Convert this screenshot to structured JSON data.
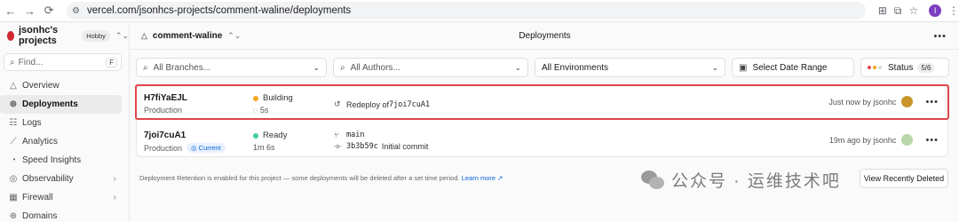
{
  "browser": {
    "url": "vercel.com/jsonhcs-projects/comment-waline/deployments",
    "back_icon": "←",
    "forward_icon": "→",
    "reload_icon": "⟳",
    "profile_initial": "I"
  },
  "sidebar": {
    "team_name": "jsonhc's projects",
    "plan": "Hobby",
    "find_placeholder": "Find...",
    "find_shortcut": "F",
    "items": [
      {
        "label": "Overview",
        "icon": "△",
        "active": false,
        "chevron": false
      },
      {
        "label": "Deployments",
        "icon": "⊛",
        "active": true,
        "chevron": false
      },
      {
        "label": "Logs",
        "icon": "☷",
        "active": false,
        "chevron": false
      },
      {
        "label": "Analytics",
        "icon": "⟋",
        "active": false,
        "chevron": false
      },
      {
        "label": "Speed Insights",
        "icon": "◔",
        "active": false,
        "chevron": false
      },
      {
        "label": "Observability",
        "icon": "◎",
        "active": false,
        "chevron": true
      },
      {
        "label": "Firewall",
        "icon": "▦",
        "active": false,
        "chevron": true
      },
      {
        "label": "Domains",
        "icon": "⊕",
        "active": false,
        "chevron": false
      }
    ]
  },
  "header": {
    "project_name": "comment-waline",
    "page_title": "Deployments",
    "more_icon": "•••"
  },
  "filters": {
    "branches_placeholder": "All Branches...",
    "authors_placeholder": "All Authors...",
    "environments_label": "All Environments",
    "date_label": "Select Date Range",
    "status_label": "Status",
    "status_count": "5/6",
    "status_dot_colors": [
      "#e5484d",
      "#f5a623",
      "#d9d9d9"
    ]
  },
  "deployments": [
    {
      "id": "H7fiYaEJL",
      "environment": "Production",
      "current": false,
      "status": "Building",
      "status_color": "#f5a623",
      "duration": "5s",
      "duration_icon": "◌",
      "commit_icon": "↺",
      "commit_prefix": "Redeploy of ",
      "commit_ref": "7joi7cuA1",
      "time": "Just now by jsonhc",
      "avatar_color": "#c8952a"
    },
    {
      "id": "7joi7cuA1",
      "environment": "Production",
      "current": true,
      "current_label": "Current",
      "status": "Ready",
      "status_color": "#3fcf8e",
      "duration": "1m 6s",
      "branch_icon": "⑂",
      "branch": "main",
      "commit_icon": "-o-",
      "commit_hash": "3b3b59c",
      "commit_message": "Initial commit",
      "time": "19m ago by jsonhc",
      "avatar_color": "#b7d7a8"
    }
  ],
  "footer": {
    "retention_text": "Deployment Retention is enabled for this project — some deployments will be deleted after a set time period.",
    "learn_more": "Learn more",
    "view_deleted": "View Recently Deleted"
  },
  "watermark": {
    "text": "公众号 · 运维技术吧"
  }
}
